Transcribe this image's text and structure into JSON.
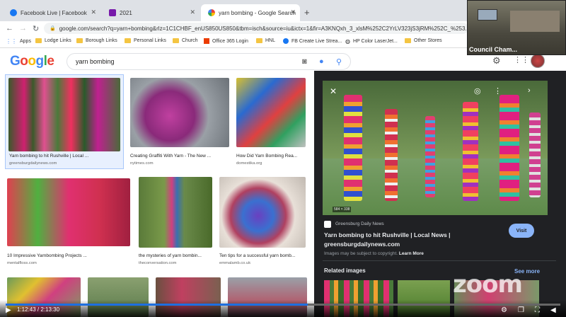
{
  "tabs": [
    {
      "title": "Facebook Live | Facebook",
      "icon": "facebook-icon",
      "color": "#1877f2"
    },
    {
      "title": "2021",
      "icon": "onenote-icon",
      "color": "#7719aa"
    },
    {
      "title": "yarn bombing - Google Search",
      "icon": "google-icon",
      "color": "#4285f4",
      "active": true
    }
  ],
  "address": {
    "url": "google.com/search?q=yarn+bombing&rlz=1C1CHBF_enUS850US850&tbm=isch&source=iu&ictx=1&fir=A3KNQxh_3_xlsM%252C2YrLV323jS3jRM%252C_%253..."
  },
  "bookmarks": [
    {
      "label": "Apps",
      "icon": "apps-icon"
    },
    {
      "label": "Lodge Links",
      "icon": "folder-icon"
    },
    {
      "label": "Borough Links",
      "icon": "folder-icon"
    },
    {
      "label": "Personal Links",
      "icon": "folder-icon"
    },
    {
      "label": "Church",
      "icon": "folder-icon"
    },
    {
      "label": "Office 365 Login",
      "icon": "office-icon"
    },
    {
      "label": "HNL",
      "icon": "folder-icon"
    },
    {
      "label": "FB Create Live Strea...",
      "icon": "facebook-icon"
    },
    {
      "label": "HP Color LaserJet...",
      "icon": "globe-icon"
    },
    {
      "label": "Other Stores",
      "icon": "folder-icon"
    }
  ],
  "google": {
    "logo": "Google",
    "query": "yarn bombing"
  },
  "results": [
    {
      "caption": "Yarn bombing to hit Rushville | Local ...",
      "source": "greensburgdailynews.com"
    },
    {
      "caption": "Creating Graffiti With Yarn - The New ...",
      "source": "nytimes.com"
    },
    {
      "caption": "How Did Yarn Bombing Rea...",
      "source": "domestika.org"
    },
    {
      "caption": "10 Impressive Yarnbombing Projects ...",
      "source": "mentalfloss.com"
    },
    {
      "caption": "the mysteries of yarn bombin...",
      "source": "theconversation.com"
    },
    {
      "caption": "Ten tips for a successful yarn bomb...",
      "source": "emmalamb.co.uk"
    }
  ],
  "panel": {
    "dimensions": "584 × 338",
    "site_name": "Greensburg Daily News",
    "title": "Yarn bombing to hit Rushville | Local News |",
    "domain": "greensburgdailynews.com",
    "visit": "Visit",
    "copyright": "Images may be subject to copyright.",
    "learn_more": "Learn More",
    "related": "Related images",
    "see_more": "See more"
  },
  "zoom_tile": {
    "label": "Council Cham..."
  },
  "video": {
    "current": "1:12:43",
    "total": "2:13:30",
    "progress": 0.545,
    "watermark": "zoom"
  }
}
